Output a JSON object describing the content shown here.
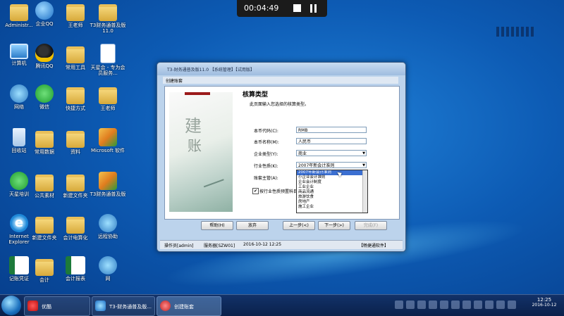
{
  "recorder": {
    "time": "00:04:49"
  },
  "desktop": {
    "icons": [
      {
        "label": "Administr...",
        "icon": "user-folder-icon"
      },
      {
        "label": "企业QQ",
        "icon": "qq-enterprise-icon"
      },
      {
        "label": "王老师",
        "icon": "folder-icon"
      },
      {
        "label": "T3财务通普及版11.0",
        "icon": "folder-icon"
      },
      {
        "label": "计算机",
        "icon": "computer-icon"
      },
      {
        "label": "腾讯QQ",
        "icon": "qq-icon"
      },
      {
        "label": "常用工具",
        "icon": "folder-icon"
      },
      {
        "label": "天星会 - 专为会员服务...",
        "icon": "document-icon"
      },
      {
        "label": "网络",
        "icon": "network-icon"
      },
      {
        "label": "微信",
        "icon": "wechat-icon"
      },
      {
        "label": "快捷方式",
        "icon": "folder-icon"
      },
      {
        "label": "王老师",
        "icon": "folder-icon"
      },
      {
        "label": "回收站",
        "icon": "recycle-bin-icon"
      },
      {
        "label": "常用数据",
        "icon": "folder-icon"
      },
      {
        "label": "资料",
        "icon": "folder-icon"
      },
      {
        "label": "Microsoft 软件",
        "icon": "software-icon"
      },
      {
        "label": "天星培训",
        "icon": "browser-icon"
      },
      {
        "label": "公共素材",
        "icon": "folder-icon"
      },
      {
        "label": "新建文件夹",
        "icon": "folder-icon"
      },
      {
        "label": "T3财务通普及版",
        "icon": "software-icon"
      },
      {
        "label": "Internet Explorer",
        "icon": "ie-icon"
      },
      {
        "label": "新建文件夹",
        "icon": "folder-icon"
      },
      {
        "label": "会计电算化",
        "icon": "folder-icon"
      },
      {
        "label": "远程协助",
        "icon": "network-icon"
      },
      {
        "label": "记账凭证",
        "icon": "excel-icon"
      },
      {
        "label": "会计",
        "icon": "folder-icon"
      },
      {
        "label": "会计报表",
        "icon": "excel-icon"
      },
      {
        "label": "网",
        "icon": "network-icon"
      }
    ]
  },
  "window": {
    "title": "T3-财务通普及版11.0 【系统管理】【试用版】",
    "menu": "创建账套",
    "page_title": "核算类型",
    "page_subtitle": "此页面输入您选择的核算类型。",
    "art_chars": [
      "建",
      "账"
    ],
    "fields": {
      "currency_code": {
        "label": "本币代码(C):",
        "value": "RMB"
      },
      "currency_name": {
        "label": "本币名称(M):",
        "value": "人民币"
      },
      "company_type": {
        "label": "企业类型(Y):",
        "value": "商业"
      },
      "industry": {
        "label": "行业性质(K):",
        "value": "2007年新会计准则"
      },
      "supervisor": {
        "label": "账套主管(A):",
        "value": ""
      }
    },
    "dropdown_options": [
      "2007年新会计准则",
      "小企业会计准则",
      "企业会计制度",
      "工业企业",
      "商品流通",
      "旅游饮食",
      "房地产",
      "施工企业"
    ],
    "checkbox": {
      "label": "按行业性质预置科目(S)",
      "checked": "✔"
    },
    "buttons": {
      "help": "帮助(H)",
      "abandon": "放弃",
      "prev": "上一步(<)",
      "next": "下一步(>)",
      "finish": "完成(F)"
    },
    "status": {
      "operator": "操作员[admin]",
      "server": "服务器[SZW01]",
      "date": "2016-10-12 12:25",
      "brand": "【畅捷通软件】"
    }
  },
  "taskbar": {
    "items": [
      {
        "label": "优酷"
      },
      {
        "label": "T3-财务通普及版..."
      },
      {
        "label": "创建账套"
      }
    ],
    "clock": {
      "time": "12:25",
      "date": "2016-10-12"
    }
  }
}
